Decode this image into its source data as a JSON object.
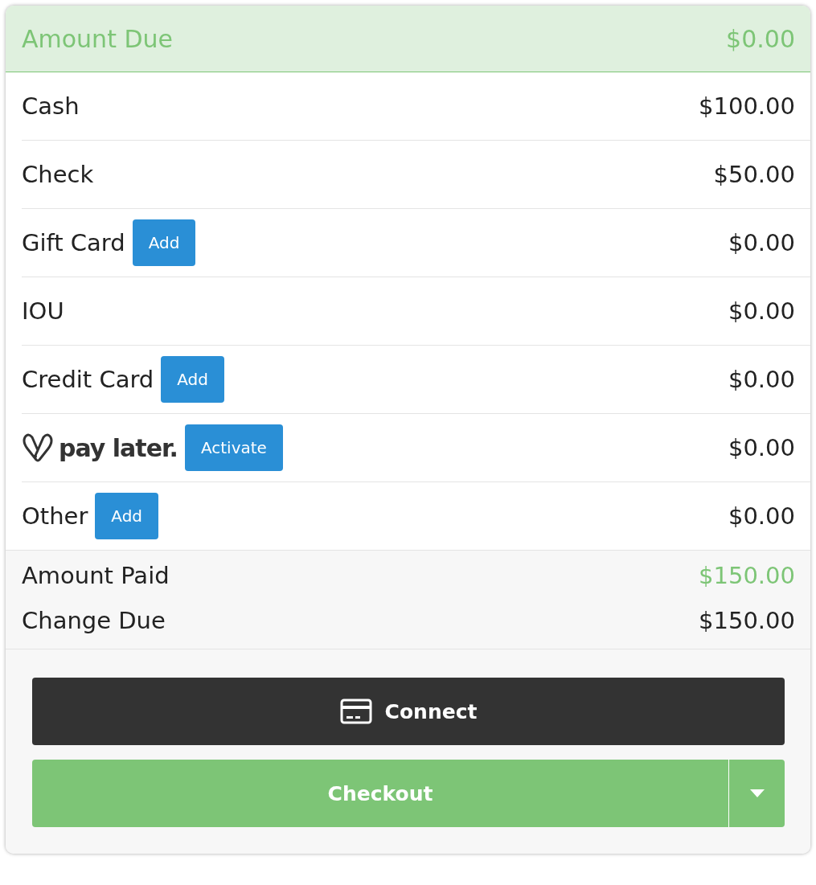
{
  "header": {
    "label": "Amount Due",
    "amount": "$0.00"
  },
  "payments": [
    {
      "kind": "plain",
      "label": "Cash",
      "amount": "$100.00"
    },
    {
      "kind": "plain",
      "label": "Check",
      "amount": "$50.00"
    },
    {
      "kind": "button",
      "label": "Gift Card",
      "button": "Add",
      "amount": "$0.00"
    },
    {
      "kind": "plain",
      "label": "IOU",
      "amount": "$0.00"
    },
    {
      "kind": "button",
      "label": "Credit Card",
      "button": "Add",
      "amount": "$0.00"
    },
    {
      "kind": "logo",
      "label": "pay later.",
      "button": "Activate",
      "amount": "$0.00"
    },
    {
      "kind": "button",
      "label": "Other",
      "button": "Add",
      "amount": "$0.00"
    }
  ],
  "summary": [
    {
      "kind": "paid",
      "label": "Amount Paid",
      "amount": "$150.00"
    },
    {
      "kind": "change",
      "label": "Change Due",
      "amount": "$150.00"
    }
  ],
  "connect_button": "Connect",
  "checkout_button": "Checkout"
}
